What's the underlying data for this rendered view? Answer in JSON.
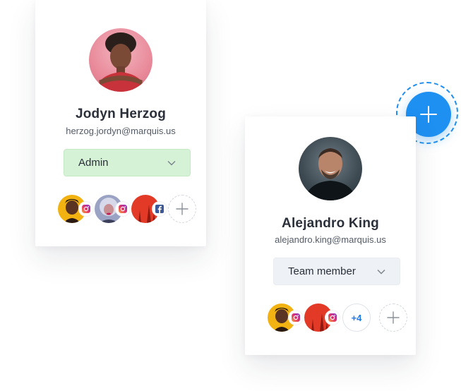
{
  "users": [
    {
      "name": "Jodyn Herzog",
      "email": "herzog.jordyn@marquis.us",
      "role": "Admin",
      "role_color": "#d6f2d6",
      "social_accounts": [
        {
          "network": "instagram-icon"
        },
        {
          "network": "instagram-icon"
        },
        {
          "network": "facebook-icon"
        }
      ]
    },
    {
      "name": "Alejandro King",
      "email": "alejandro.king@marquis.us",
      "role": "Team member",
      "role_color": "#eef1f5",
      "social_accounts": [
        {
          "network": "instagram-icon"
        },
        {
          "network": "instagram-icon"
        }
      ],
      "more_count": "+4"
    }
  ],
  "colors": {
    "accent": "#1e90f2",
    "count_text": "#1f7ae8"
  }
}
